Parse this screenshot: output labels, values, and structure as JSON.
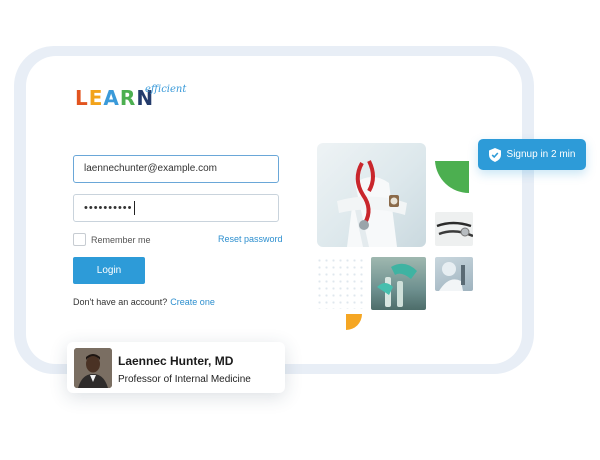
{
  "brand": {
    "logo_letters": [
      "L",
      "E",
      "A",
      "R",
      "N"
    ],
    "logo_subtext": "efficient"
  },
  "login_form": {
    "email_value": "laennechunter@example.com",
    "password_masked": "••••••••••",
    "remember_label": "Remember me",
    "reset_label": "Reset password",
    "login_label": "Login",
    "no_account_text": "Don't have an account?",
    "create_link": "Create one"
  },
  "badge": {
    "label": "Signup in 2 min",
    "icon": "shield-check-icon"
  },
  "profile": {
    "name": "Laennec Hunter, MD",
    "title": "Professor of Internal Medicine"
  },
  "colors": {
    "accent": "#2d9bd8",
    "frame": "#e8eef6",
    "green_accent": "#4caf50",
    "orange_accent": "#f5a623"
  }
}
